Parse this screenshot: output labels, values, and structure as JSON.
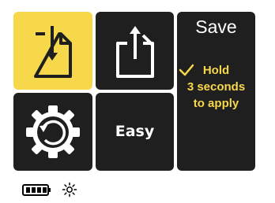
{
  "tiles": {
    "import": {
      "icon": "import-file-icon",
      "selected": true
    },
    "export": {
      "icon": "export-file-icon",
      "selected": false
    },
    "reset": {
      "icon": "reset-dial-icon",
      "selected": false
    },
    "mode": {
      "label": "Easy"
    },
    "save": {
      "title": "Save",
      "hold_label": "Hold",
      "hold_icon": "checkmark-icon",
      "line2": "3 seconds",
      "line3": "to apply"
    }
  },
  "status_bar": {
    "battery_icon": "battery-icon",
    "brightness_icon": "brightness-icon"
  },
  "colors": {
    "tile_bg": "#1f1f1f",
    "accent": "#f7d84a",
    "icon_white": "#ffffff"
  }
}
